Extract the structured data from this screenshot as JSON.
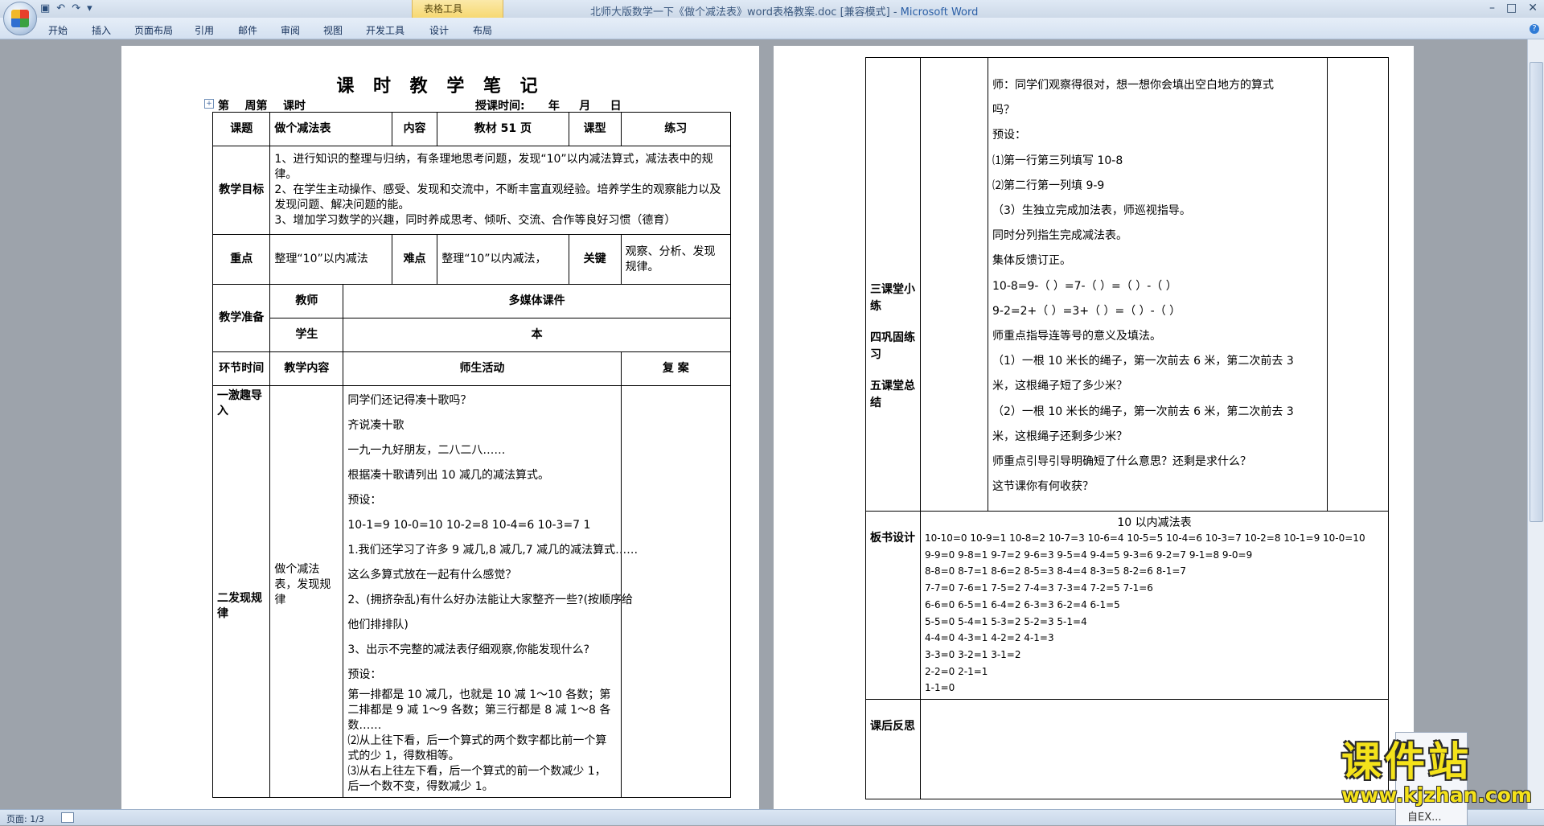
{
  "window": {
    "title_doc": "北师大版数学一下《做个减法表》word表格教案.doc [兼容模式] - ",
    "title_app": "Microsoft Word",
    "tool_group": "表格工具",
    "controls": [
      "–",
      "□",
      "✕"
    ]
  },
  "ribbon": {
    "tabs": [
      "开始",
      "插入",
      "页面布局",
      "引用",
      "邮件",
      "审阅",
      "视图",
      "开发工具",
      "设计",
      "布局"
    ],
    "help": "?"
  },
  "status": {
    "page": "页面: 1/3"
  },
  "page1": {
    "title": "课 时 教 学 笔 记",
    "week_line": "第    周第    课时",
    "date_line": "授课时间:      年     月     日",
    "labels": {
      "topic": "课题",
      "content": "内容",
      "type": "课型",
      "goals": "教学目标",
      "key": "重点",
      "difficult": "难点",
      "crux": "关键",
      "prep": "教学准备",
      "teacher": "教师",
      "student": "学生",
      "stage": "环节时间",
      "teach_content": "教学内容",
      "activity": "师生活动",
      "review": "复 案"
    },
    "values": {
      "topic": "做个减法表",
      "content": "教材 51 页",
      "type": "练习",
      "goal1": "1、进行知识的整理与归纳，有条理地思考问题，发现“10”以内减法算式，减法表中的规律。",
      "goal2": "2、在学生主动操作、感受、发现和交流中，不断丰富直观经验。培养学生的观察能力以及发现问题、解决问题的能。",
      "goal3": "3、增加学习数学的兴趣，同时养成思考、倾听、交流、合作等良好习惯（德育）",
      "key": "整理“10”以内减法",
      "difficult": "整理“10”以内减法，",
      "crux": "观察、分析、发现规律。",
      "teacher": "多媒体课件",
      "student": "本"
    },
    "stages": {
      "s1": "一激趣导入",
      "s2": "二发现规律",
      "content_mid": "做个减法表，发现规律"
    },
    "activities": [
      "同学们还记得凑十歌吗？",
      "齐说凑十歌",
      "一九一九好朋友，二八二八……",
      "根据凑十歌请列出 10 减几的减法算式。",
      "预设：",
      "10-1=9   10-0=10   10-2=8   10-4=6   10-3=7   1",
      "1.我们还学习了许多 9 减几,8 减几,7 减几的减法算式……",
      "这么多算式放在一起有什么感觉？",
      "2、(拥挤杂乱)有什么好办法能让大家整齐一些?(按顺序给",
      "他们排排队)",
      "3、出示不完整的减法表仔细观察,你能发现什么?",
      "预设："
    ],
    "activities_wrap": [
      "第一排都是 10 减几，也就是 10 减 1～10 各数；第二排都是 9 减 1～9 各数；第三行都是 8 减 1～8 各数……",
      "⑵从上往下看，后一个算式的两个数字都比前一个算式的少 1，得数相等。",
      "⑶从右上往左下看，后一个算式的前一个数减少 1，后一个数不变，得数减少 1。"
    ]
  },
  "page2": {
    "stages": {
      "s3": "三课堂小练",
      "s4": "四巩固练习",
      "s5": "五课堂总结"
    },
    "activities": [
      "师：同学们观察得很对，想一想你会填出空白地方的算式",
      "吗？",
      "预设：",
      "⑴第一行第三列填写 10-8",
      "⑵第二行第一列填 9-9",
      "（3）生独立完成加法表，师巡视指导。",
      "同时分列指生完成减法表。",
      "集体反馈订正。",
      "10-8=9-（  ）=7-（  ）=（  ）-（  ）",
      "9-2=2+（  ）=3+（   ）=（  ）-（  ）",
      "师重点指导连等号的意义及填法。",
      "（1）一根 10 米长的绳子，第一次前去 6 米，第二次前去 3",
      "米，这根绳子短了多少米？",
      "（2）一根 10 米长的绳子，第一次前去 6 米，第二次前去 3",
      "米，这根绳子还剩多少米？",
      "师重点引导引导明确短了什么意思？还剩是求什么？",
      "这节课你有何收获？"
    ],
    "board_label": "板书设计",
    "board_title": "10 以内减法表",
    "board_lines": [
      "10-10=0 10-9=1 10-8=2 10-7=3 10-6=4 10-5=5 10-4=6 10-3=7 10-2=8 10-1=9 10-0=10",
      "9-9=0 9-8=1 9-7=2 9-6=3 9-5=4 9-4=5 9-3=6 9-2=7 9-1=8 9-0=9",
      "8-8=0 8-7=1 8-6=2 8-5=3 8-4=4 8-3=5 8-2=6 8-1=7",
      "7-7=0 7-6=1 7-5=2 7-4=3 7-3=4 7-2=5 7-1=6",
      "6-6=0 6-5=1 6-4=2 6-3=3 6-2=4 6-1=5",
      "5-5=0 5-4=1 5-3=2 5-2=3 5-1=4",
      "4-4=0 4-3=1 4-2=2 4-1=3",
      "3-3=0 3-2=1 3-1=2",
      "2-2=0 2-1=1",
      "1-1=0"
    ],
    "reflect_label": "课后反思"
  },
  "watermark": {
    "cn": "课件站",
    "url": "www.kjzhan.com"
  },
  "popup": {
    "text": "自EX..."
  }
}
